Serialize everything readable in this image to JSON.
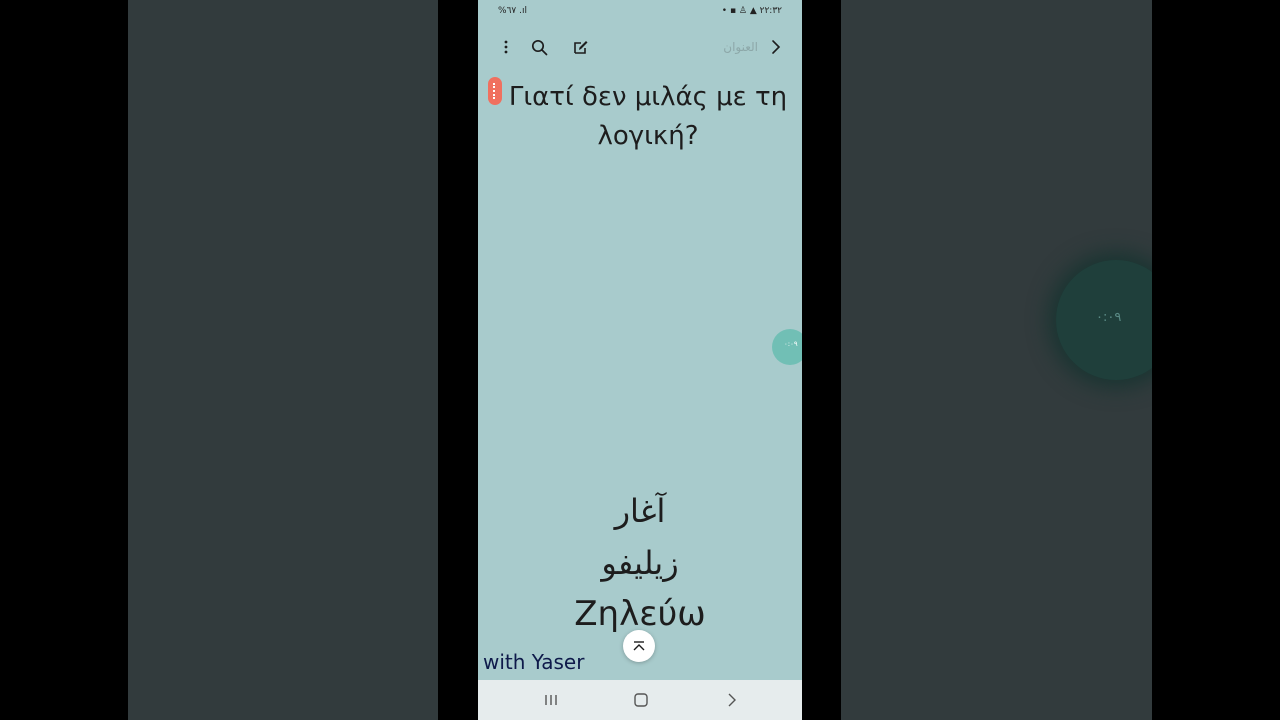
{
  "status_bar": {
    "left_text": "%٦٧ .ıl",
    "right_text": "• ▪ ♙ ▲ ٢٢:٣٢"
  },
  "toolbar": {
    "title_placeholder": "العنوان",
    "menu_icon": "more-vert-icon",
    "search_icon": "search-icon",
    "edit_icon": "edit-icon",
    "back_icon": "chevron-right-icon"
  },
  "content": {
    "greek_question": "Γιατί δεν μιλάς με τη λογική?",
    "words": [
      "آغار",
      "زيليفو",
      "Ζηλεύω"
    ],
    "watermark": "with Yaser"
  },
  "floating_bubble": {
    "label": "٠:٠٩"
  },
  "nav_bar": {
    "recent_icon": "recent-apps-icon",
    "home_icon": "home-icon",
    "back_icon": "back-icon"
  },
  "colors": {
    "page_background": "#a8cbcc",
    "drag_handle": "#f0705f",
    "bubble": "#6fbfb4",
    "watermark": "#0e1a4a"
  }
}
